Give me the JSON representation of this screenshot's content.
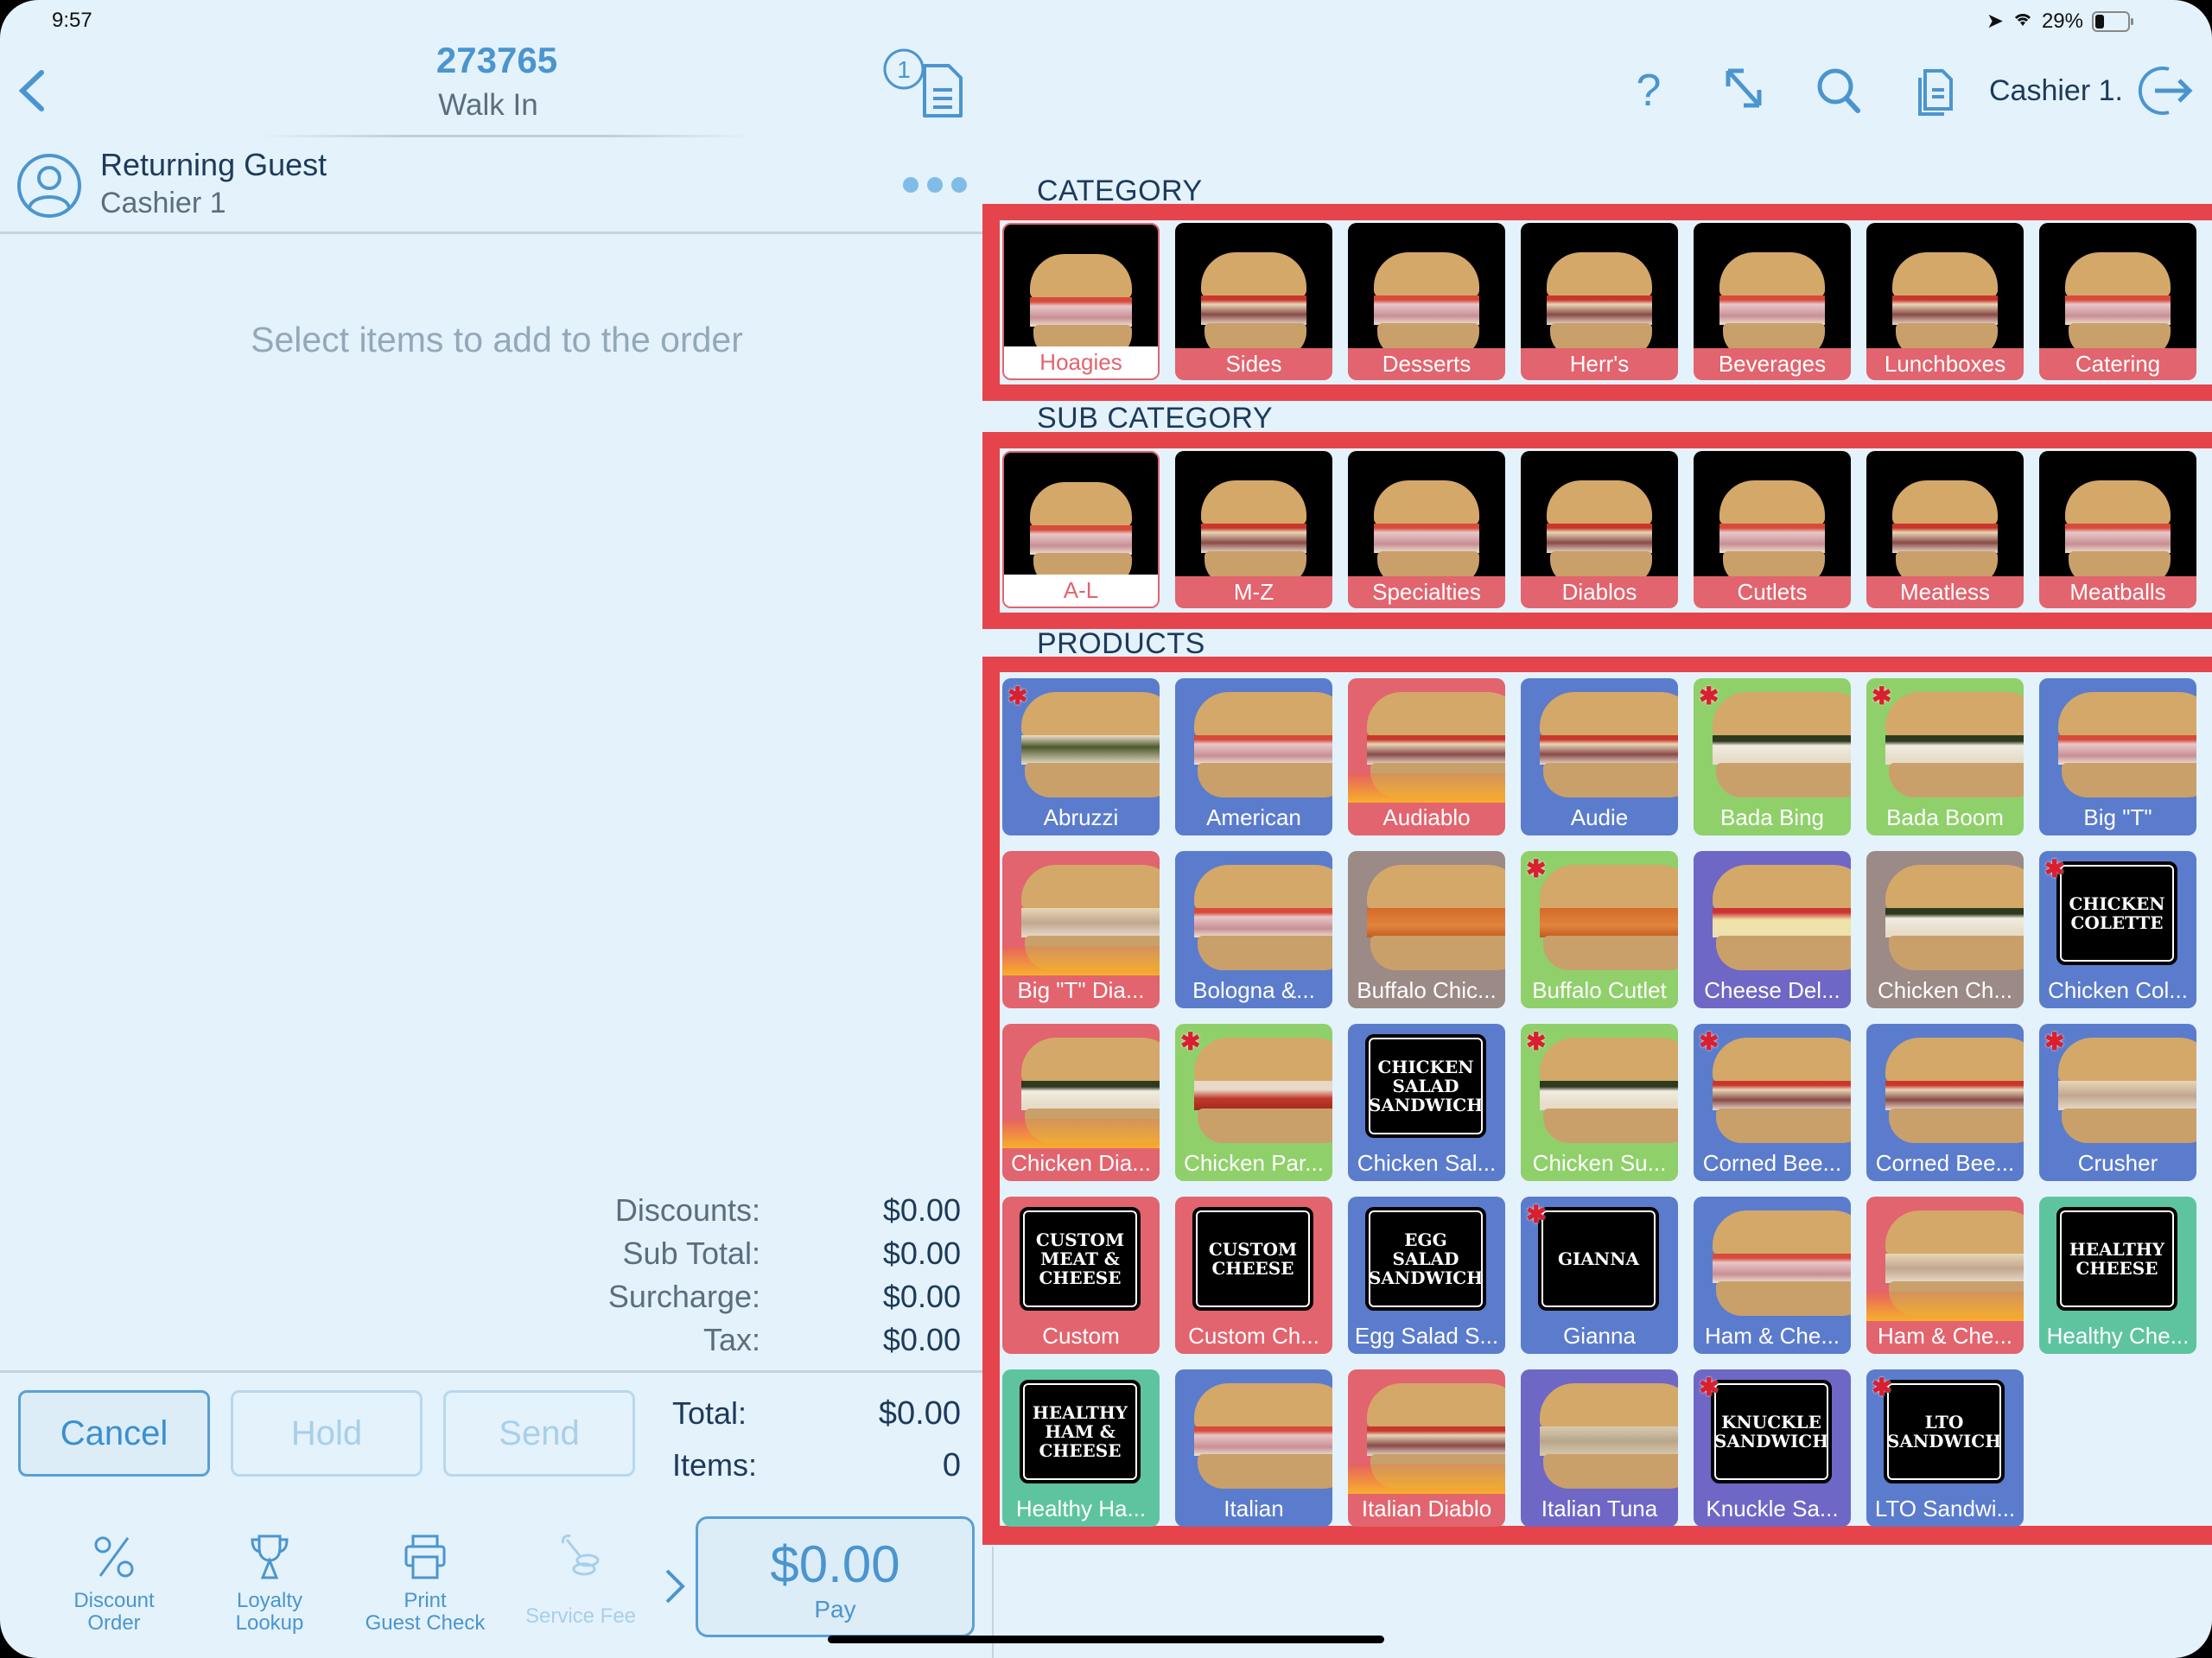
{
  "status_bar": {
    "time": "9:57",
    "battery": "29%",
    "battery_level": 0.29
  },
  "order": {
    "number": "273765",
    "type": "Walk In",
    "open_checks_count": "1",
    "guest_name": "Returning Guest",
    "cashier": "Cashier 1",
    "empty_message": "Select items to add to the order"
  },
  "summary": [
    {
      "label": "Discounts:",
      "value": "$0.00"
    },
    {
      "label": "Sub Total:",
      "value": "$0.00"
    },
    {
      "label": "Surcharge:",
      "value": "$0.00"
    },
    {
      "label": "Tax:",
      "value": "$0.00"
    }
  ],
  "grand": {
    "total_label": "Total:",
    "total_value": "$0.00",
    "items_label": "Items:",
    "items_value": "0"
  },
  "buttons": {
    "cancel": "Cancel",
    "hold": "Hold",
    "send": "Send"
  },
  "actions": [
    {
      "label": "Discount\nOrder",
      "icon": "percent-icon"
    },
    {
      "label": "Loyalty\nLookup",
      "icon": "trophy-icon"
    },
    {
      "label": "Print\nGuest Check",
      "icon": "printer-icon"
    },
    {
      "label": "Service Fee",
      "icon": "wrench-coins-icon",
      "disabled": true
    }
  ],
  "pay": {
    "amount": "$0.00",
    "label": "Pay"
  },
  "toolbar": {
    "cashier": "Cashier 1."
  },
  "sections": {
    "category": "CATEGORY",
    "sub_category": "SUB CATEGORY",
    "products": "PRODUCTS"
  },
  "colors": {
    "highlight": "#e6444c",
    "accent": "#4b95cf",
    "tile_red": "#e2646e",
    "tile_blue": "#5b7ccc",
    "tile_green": "#8fd06a",
    "tile_purple": "#6e67c6",
    "tile_taupe": "#9b8a86",
    "tile_teal": "#5ec4a0"
  },
  "categories": [
    {
      "label": "Hoagies",
      "selected": true
    },
    {
      "label": "Sides"
    },
    {
      "label": "Desserts"
    },
    {
      "label": "Herr's"
    },
    {
      "label": "Beverages"
    },
    {
      "label": "Lunchboxes"
    },
    {
      "label": "Catering"
    }
  ],
  "sub_categories": [
    {
      "label": "A-L",
      "selected": true
    },
    {
      "label": "M-Z"
    },
    {
      "label": "Specialties"
    },
    {
      "label": "Diablos"
    },
    {
      "label": "Cutlets"
    },
    {
      "label": "Meatless"
    },
    {
      "label": "Meatballs"
    }
  ],
  "products": [
    {
      "label": "Abruzzi",
      "color": "blue",
      "star": true,
      "fill": "greens"
    },
    {
      "label": "American",
      "color": "blue",
      "fill": "ham"
    },
    {
      "label": "Audiablo",
      "color": "red",
      "fill": "beef",
      "flames": true
    },
    {
      "label": "Audie",
      "color": "blue",
      "fill": "beef"
    },
    {
      "label": "Bada Bing",
      "color": "green",
      "star": true,
      "fill": "chicken"
    },
    {
      "label": "Bada Boom",
      "color": "green",
      "star": true,
      "fill": "chicken"
    },
    {
      "label": "Big \"T\"",
      "color": "blue",
      "fill": "ham"
    },
    {
      "label": "Big \"T\" Dia...",
      "color": "red",
      "fill": "turkey",
      "flames": true
    },
    {
      "label": "Bologna &...",
      "color": "blue",
      "fill": "ham"
    },
    {
      "label": "Buffalo Chic...",
      "color": "taupe",
      "fill": "buffalo"
    },
    {
      "label": "Buffalo Cutlet",
      "color": "green",
      "star": true,
      "fill": "buffalo"
    },
    {
      "label": "Cheese Del...",
      "color": "purple",
      "fill": "cheese"
    },
    {
      "label": "Chicken Ch...",
      "color": "taupe",
      "fill": "chicken"
    },
    {
      "label": "Chicken Col...",
      "color": "blue",
      "star": true,
      "sign": "CHICKEN\nCOLETTE"
    },
    {
      "label": "Chicken Dia...",
      "color": "red",
      "fill": "chicken",
      "flames": true
    },
    {
      "label": "Chicken Par...",
      "color": "green",
      "star": true,
      "fill": "parm"
    },
    {
      "label": "Chicken Sal...",
      "color": "blue",
      "sign": "CHICKEN\nSALAD\nSANDWICH"
    },
    {
      "label": "Chicken Su...",
      "color": "green",
      "star": true,
      "fill": "chicken"
    },
    {
      "label": "Corned Bee...",
      "color": "blue",
      "star": true,
      "fill": "beef"
    },
    {
      "label": "Corned Bee...",
      "color": "blue",
      "fill": "beef"
    },
    {
      "label": "Crusher",
      "color": "blue",
      "star": true,
      "fill": "turkey"
    },
    {
      "label": "Custom",
      "color": "red",
      "sign": "CUSTOM\nMEAT &\nCHEESE"
    },
    {
      "label": "Custom Ch...",
      "color": "red",
      "sign": "CUSTOM\nCHEESE"
    },
    {
      "label": "Egg Salad S...",
      "color": "blue",
      "sign": "EGG SALAD\nSANDWICH"
    },
    {
      "label": "Gianna",
      "color": "blue",
      "star": true,
      "sign": "GIANNA"
    },
    {
      "label": "Ham & Che...",
      "color": "blue",
      "fill": "ham"
    },
    {
      "label": "Ham & Che...",
      "color": "red",
      "fill": "turkey",
      "flames": true
    },
    {
      "label": "Healthy Che...",
      "color": "teal",
      "sign": "HEALTHY\nCHEESE"
    },
    {
      "label": "Healthy Ha...",
      "color": "teal",
      "sign": "HEALTHY\nHAM &\nCHEESE"
    },
    {
      "label": "Italian",
      "color": "blue",
      "fill": "ham"
    },
    {
      "label": "Italian Diablo",
      "color": "red",
      "fill": "beef",
      "flames": true
    },
    {
      "label": "Italian Tuna",
      "color": "purple",
      "fill": "tuna"
    },
    {
      "label": "Knuckle Sa...",
      "color": "purple",
      "star": true,
      "sign": "KNUCKLE\nSANDWICH"
    },
    {
      "label": "LTO Sandwi...",
      "color": "blue",
      "star": true,
      "sign": "LTO\nSANDWICH"
    }
  ]
}
